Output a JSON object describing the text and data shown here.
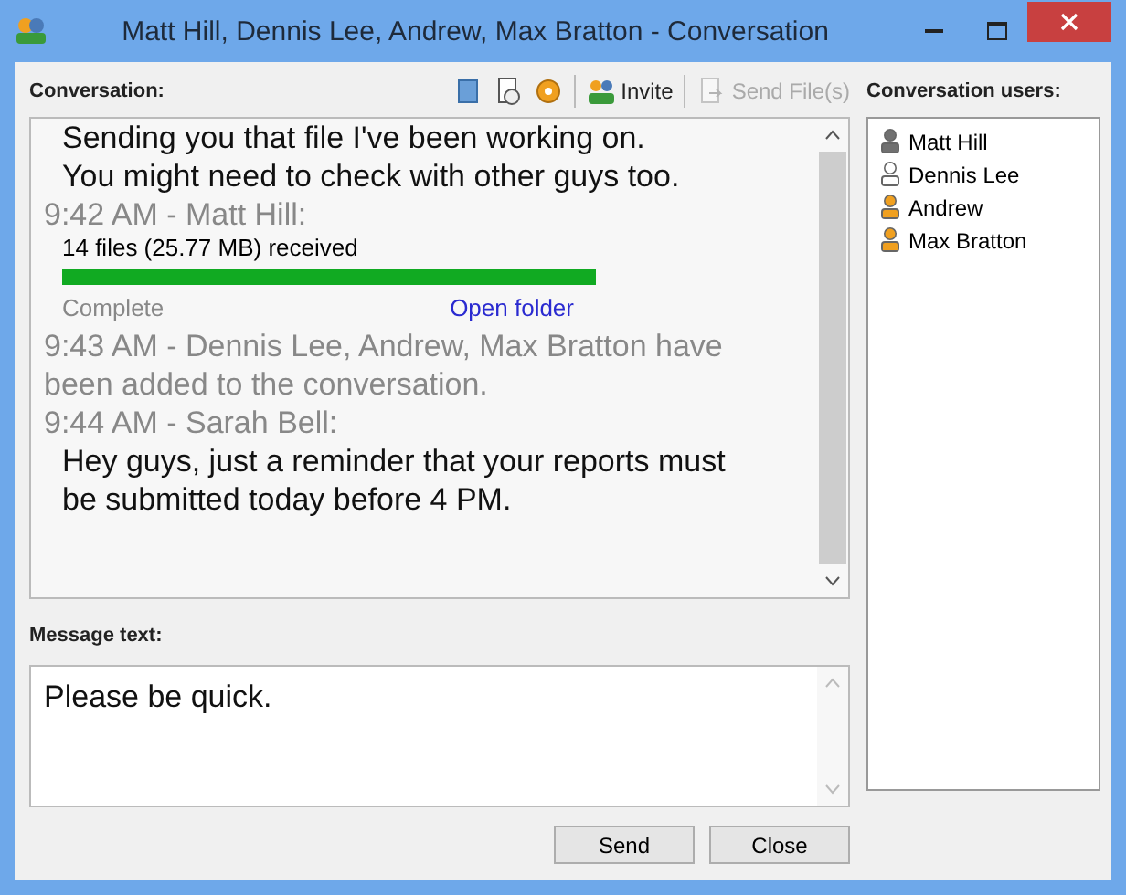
{
  "window": {
    "title": "Matt Hill, Dennis Lee, Andrew, Max Bratton - Conversation"
  },
  "conversation": {
    "label": "Conversation:",
    "toolbar": [
      {
        "kind": "icon",
        "disabled": false
      },
      {
        "kind": "icon",
        "disabled": false
      },
      {
        "kind": "icon",
        "disabled": false
      },
      {
        "kind": "separator"
      },
      {
        "kind": "button",
        "label": "Invite",
        "disabled": false
      },
      {
        "kind": "separator"
      },
      {
        "kind": "button",
        "label": "Send File(s)",
        "disabled": true
      }
    ],
    "messages": [
      {
        "kind": "text",
        "text": "Sending you that file I've been working on."
      },
      {
        "kind": "text",
        "text": "You might need to check with other guys too."
      },
      {
        "kind": "header",
        "text": "9:42 AM - Matt Hill:"
      },
      {
        "kind": "file",
        "summary": "14 files (25.77 MB) received",
        "level": 1,
        "status": "Complete",
        "link": "Open folder"
      },
      {
        "kind": "header",
        "text": "9:43 AM - Dennis Lee, Andrew, Max Bratton have been added to the conversation."
      },
      {
        "kind": "header",
        "text": "9:44 AM - Sarah Bell:"
      },
      {
        "kind": "text",
        "text": "Hey guys, just a reminder that your reports must be submitted today before 4 PM."
      }
    ]
  },
  "message": {
    "label": "Message text:",
    "value": "Please be quick."
  },
  "users": {
    "label": "Conversation users:",
    "items": [
      {
        "name": "Matt Hill",
        "color": "#707070"
      },
      {
        "name": "Dennis Lee",
        "color": "#ffffff"
      },
      {
        "name": "Andrew",
        "color": "#f0a020"
      },
      {
        "name": "Max Bratton",
        "color": "#f0a020"
      }
    ]
  },
  "buttons": [
    "Send",
    "Close"
  ]
}
